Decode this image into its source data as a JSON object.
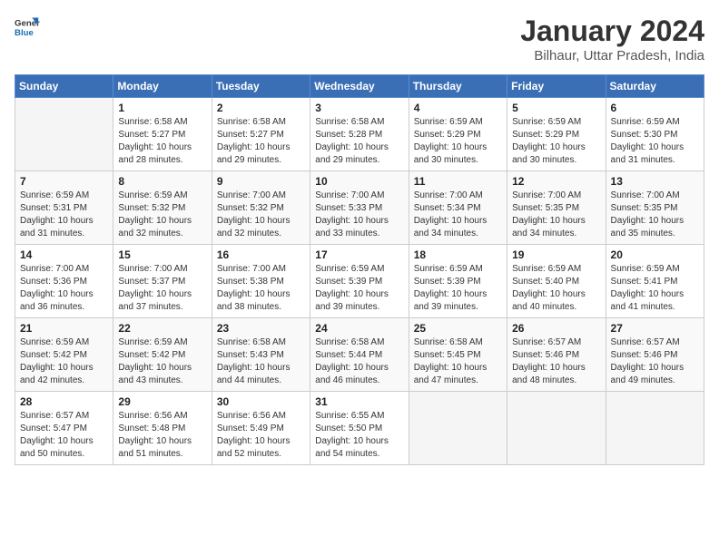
{
  "header": {
    "logo_line1": "General",
    "logo_line2": "Blue",
    "month_year": "January 2024",
    "location": "Bilhaur, Uttar Pradesh, India"
  },
  "days_of_week": [
    "Sunday",
    "Monday",
    "Tuesday",
    "Wednesday",
    "Thursday",
    "Friday",
    "Saturday"
  ],
  "weeks": [
    [
      {
        "day": "",
        "empty": true
      },
      {
        "day": "1",
        "sunrise": "Sunrise: 6:58 AM",
        "sunset": "Sunset: 5:27 PM",
        "daylight": "Daylight: 10 hours and 28 minutes."
      },
      {
        "day": "2",
        "sunrise": "Sunrise: 6:58 AM",
        "sunset": "Sunset: 5:27 PM",
        "daylight": "Daylight: 10 hours and 29 minutes."
      },
      {
        "day": "3",
        "sunrise": "Sunrise: 6:58 AM",
        "sunset": "Sunset: 5:28 PM",
        "daylight": "Daylight: 10 hours and 29 minutes."
      },
      {
        "day": "4",
        "sunrise": "Sunrise: 6:59 AM",
        "sunset": "Sunset: 5:29 PM",
        "daylight": "Daylight: 10 hours and 30 minutes."
      },
      {
        "day": "5",
        "sunrise": "Sunrise: 6:59 AM",
        "sunset": "Sunset: 5:29 PM",
        "daylight": "Daylight: 10 hours and 30 minutes."
      },
      {
        "day": "6",
        "sunrise": "Sunrise: 6:59 AM",
        "sunset": "Sunset: 5:30 PM",
        "daylight": "Daylight: 10 hours and 31 minutes."
      }
    ],
    [
      {
        "day": "7",
        "sunrise": "Sunrise: 6:59 AM",
        "sunset": "Sunset: 5:31 PM",
        "daylight": "Daylight: 10 hours and 31 minutes."
      },
      {
        "day": "8",
        "sunrise": "Sunrise: 6:59 AM",
        "sunset": "Sunset: 5:32 PM",
        "daylight": "Daylight: 10 hours and 32 minutes."
      },
      {
        "day": "9",
        "sunrise": "Sunrise: 7:00 AM",
        "sunset": "Sunset: 5:32 PM",
        "daylight": "Daylight: 10 hours and 32 minutes."
      },
      {
        "day": "10",
        "sunrise": "Sunrise: 7:00 AM",
        "sunset": "Sunset: 5:33 PM",
        "daylight": "Daylight: 10 hours and 33 minutes."
      },
      {
        "day": "11",
        "sunrise": "Sunrise: 7:00 AM",
        "sunset": "Sunset: 5:34 PM",
        "daylight": "Daylight: 10 hours and 34 minutes."
      },
      {
        "day": "12",
        "sunrise": "Sunrise: 7:00 AM",
        "sunset": "Sunset: 5:35 PM",
        "daylight": "Daylight: 10 hours and 34 minutes."
      },
      {
        "day": "13",
        "sunrise": "Sunrise: 7:00 AM",
        "sunset": "Sunset: 5:35 PM",
        "daylight": "Daylight: 10 hours and 35 minutes."
      }
    ],
    [
      {
        "day": "14",
        "sunrise": "Sunrise: 7:00 AM",
        "sunset": "Sunset: 5:36 PM",
        "daylight": "Daylight: 10 hours and 36 minutes."
      },
      {
        "day": "15",
        "sunrise": "Sunrise: 7:00 AM",
        "sunset": "Sunset: 5:37 PM",
        "daylight": "Daylight: 10 hours and 37 minutes."
      },
      {
        "day": "16",
        "sunrise": "Sunrise: 7:00 AM",
        "sunset": "Sunset: 5:38 PM",
        "daylight": "Daylight: 10 hours and 38 minutes."
      },
      {
        "day": "17",
        "sunrise": "Sunrise: 6:59 AM",
        "sunset": "Sunset: 5:39 PM",
        "daylight": "Daylight: 10 hours and 39 minutes."
      },
      {
        "day": "18",
        "sunrise": "Sunrise: 6:59 AM",
        "sunset": "Sunset: 5:39 PM",
        "daylight": "Daylight: 10 hours and 39 minutes."
      },
      {
        "day": "19",
        "sunrise": "Sunrise: 6:59 AM",
        "sunset": "Sunset: 5:40 PM",
        "daylight": "Daylight: 10 hours and 40 minutes."
      },
      {
        "day": "20",
        "sunrise": "Sunrise: 6:59 AM",
        "sunset": "Sunset: 5:41 PM",
        "daylight": "Daylight: 10 hours and 41 minutes."
      }
    ],
    [
      {
        "day": "21",
        "sunrise": "Sunrise: 6:59 AM",
        "sunset": "Sunset: 5:42 PM",
        "daylight": "Daylight: 10 hours and 42 minutes."
      },
      {
        "day": "22",
        "sunrise": "Sunrise: 6:59 AM",
        "sunset": "Sunset: 5:42 PM",
        "daylight": "Daylight: 10 hours and 43 minutes."
      },
      {
        "day": "23",
        "sunrise": "Sunrise: 6:58 AM",
        "sunset": "Sunset: 5:43 PM",
        "daylight": "Daylight: 10 hours and 44 minutes."
      },
      {
        "day": "24",
        "sunrise": "Sunrise: 6:58 AM",
        "sunset": "Sunset: 5:44 PM",
        "daylight": "Daylight: 10 hours and 46 minutes."
      },
      {
        "day": "25",
        "sunrise": "Sunrise: 6:58 AM",
        "sunset": "Sunset: 5:45 PM",
        "daylight": "Daylight: 10 hours and 47 minutes."
      },
      {
        "day": "26",
        "sunrise": "Sunrise: 6:57 AM",
        "sunset": "Sunset: 5:46 PM",
        "daylight": "Daylight: 10 hours and 48 minutes."
      },
      {
        "day": "27",
        "sunrise": "Sunrise: 6:57 AM",
        "sunset": "Sunset: 5:46 PM",
        "daylight": "Daylight: 10 hours and 49 minutes."
      }
    ],
    [
      {
        "day": "28",
        "sunrise": "Sunrise: 6:57 AM",
        "sunset": "Sunset: 5:47 PM",
        "daylight": "Daylight: 10 hours and 50 minutes."
      },
      {
        "day": "29",
        "sunrise": "Sunrise: 6:56 AM",
        "sunset": "Sunset: 5:48 PM",
        "daylight": "Daylight: 10 hours and 51 minutes."
      },
      {
        "day": "30",
        "sunrise": "Sunrise: 6:56 AM",
        "sunset": "Sunset: 5:49 PM",
        "daylight": "Daylight: 10 hours and 52 minutes."
      },
      {
        "day": "31",
        "sunrise": "Sunrise: 6:55 AM",
        "sunset": "Sunset: 5:50 PM",
        "daylight": "Daylight: 10 hours and 54 minutes."
      },
      {
        "day": "",
        "empty": true
      },
      {
        "day": "",
        "empty": true
      },
      {
        "day": "",
        "empty": true
      }
    ]
  ]
}
